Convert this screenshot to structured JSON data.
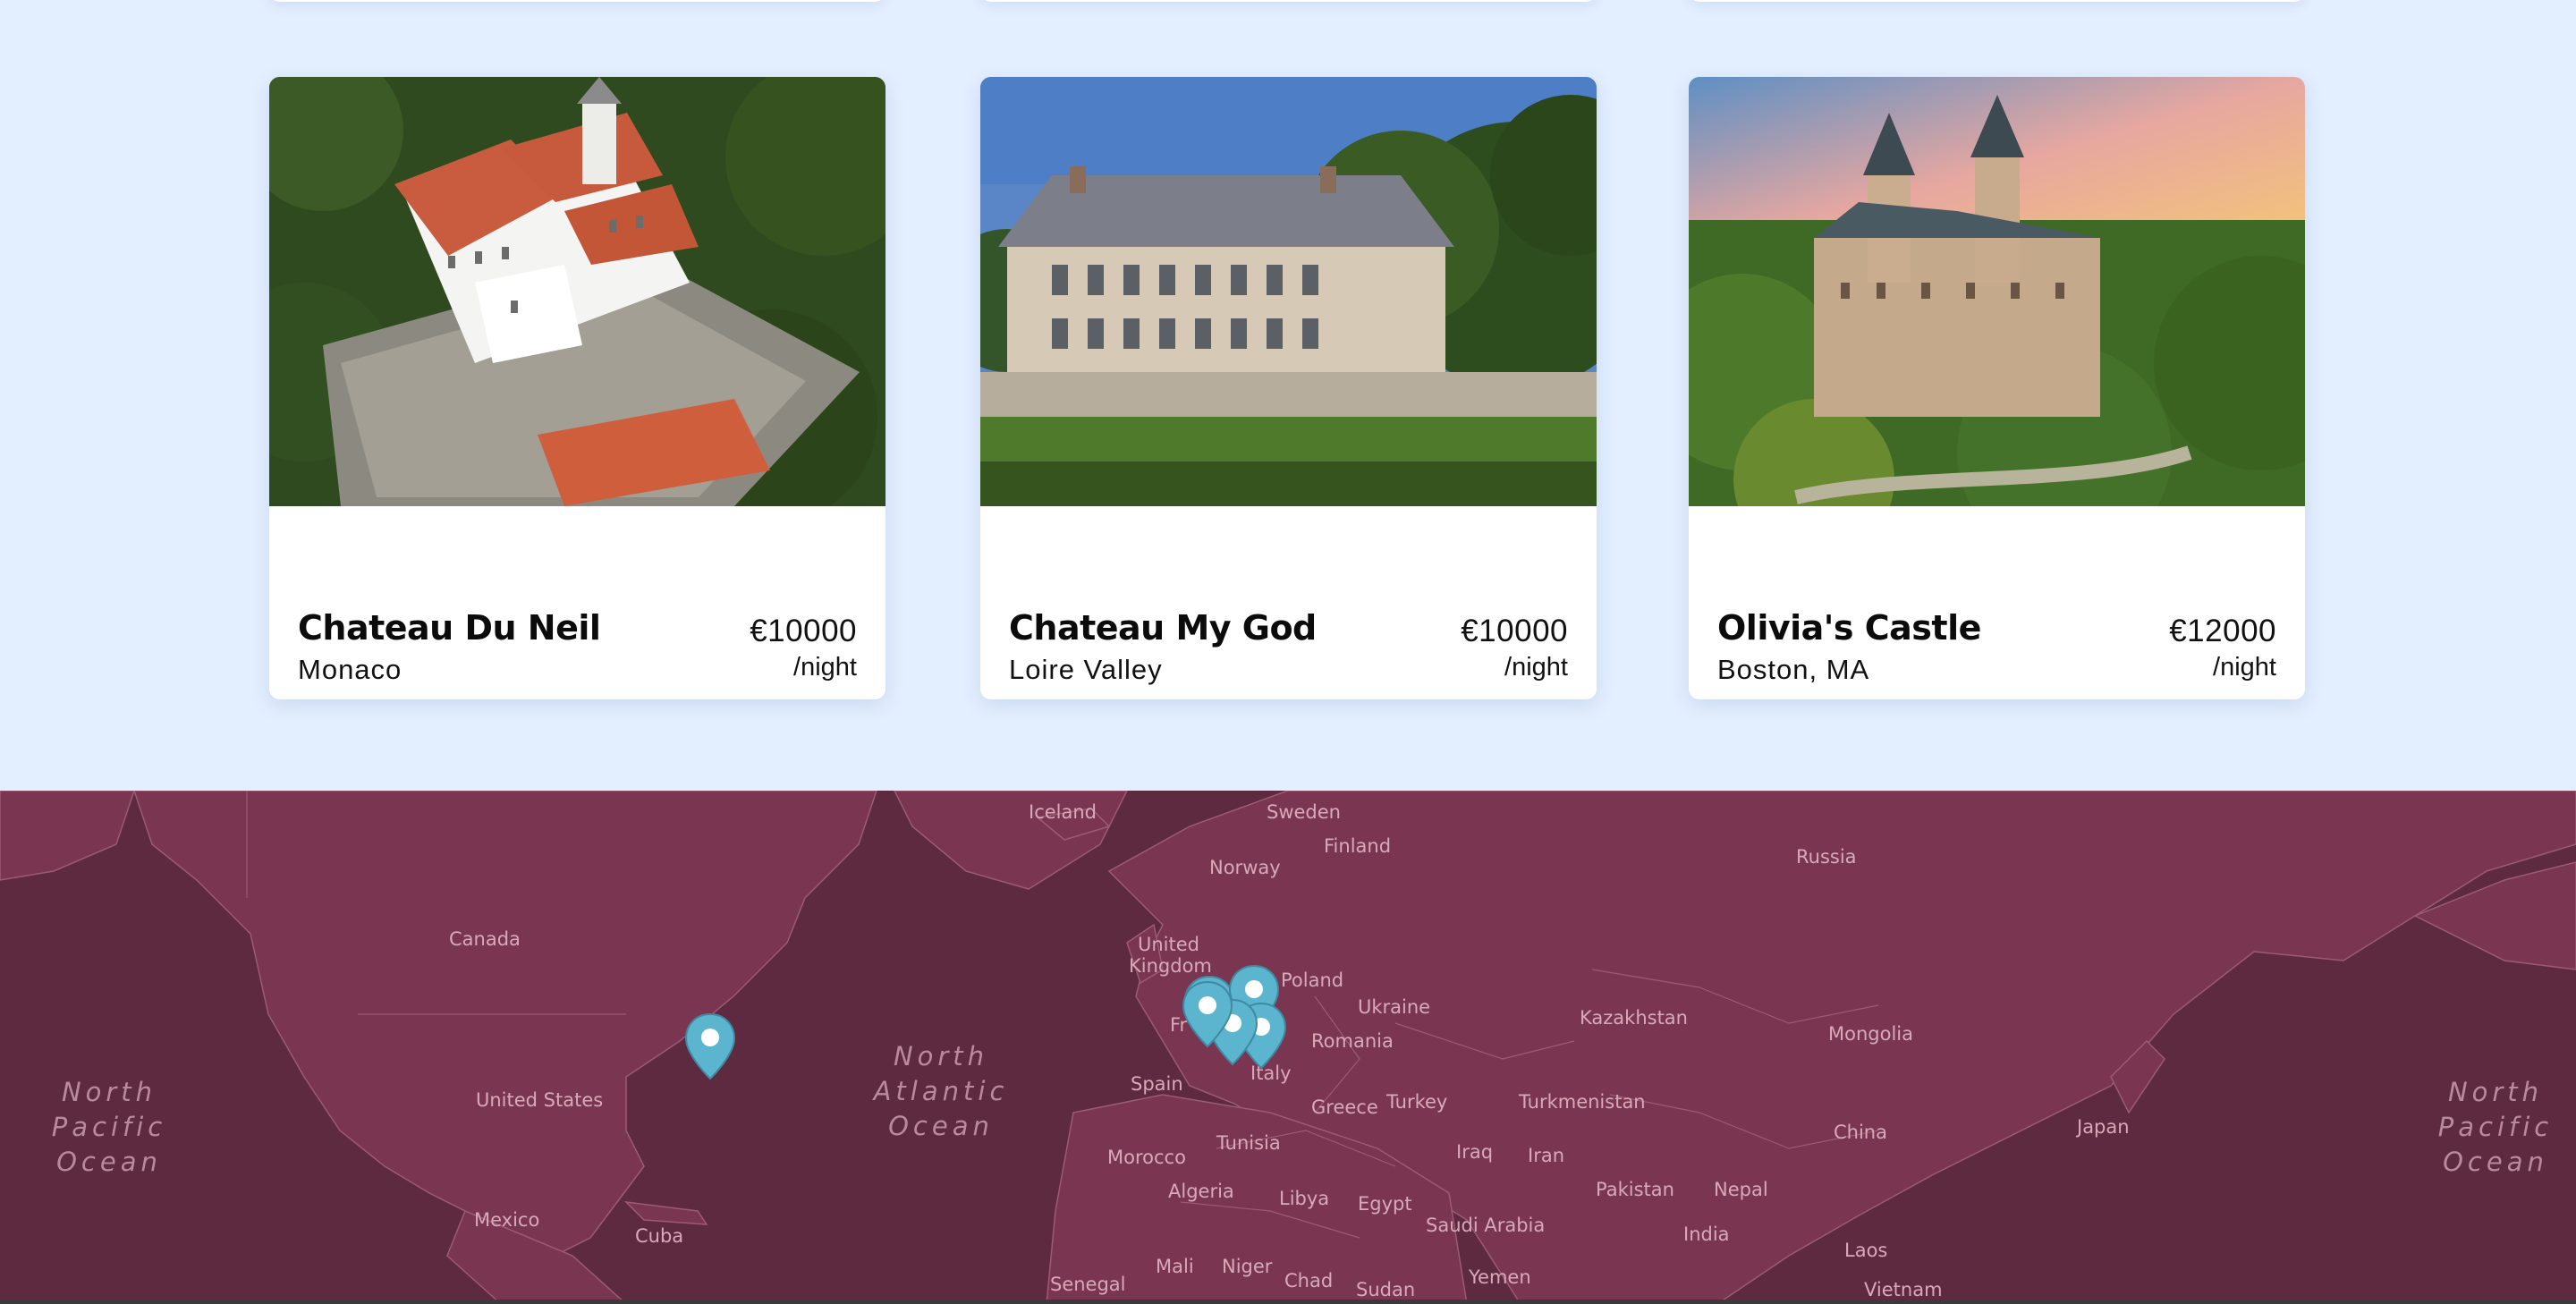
{
  "listings": [
    {
      "name": "Chateau Du Neil",
      "location": "Monaco",
      "price": "€10000",
      "per": "/night"
    },
    {
      "name": "Chateau My God",
      "location": "Loire Valley",
      "price": "€10000",
      "per": "/night"
    },
    {
      "name": "Olivia's Castle",
      "location": "Boston, MA",
      "price": "€12000",
      "per": "/night"
    }
  ],
  "map": {
    "labels": {
      "iceland": "Iceland",
      "sweden": "Sweden",
      "finland": "Finland",
      "norway": "Norway",
      "russia": "Russia",
      "canada": "Canada",
      "united_kingdom_1": "United",
      "united_kingdom_2": "Kingdom",
      "poland": "Poland",
      "ukraine": "Ukraine",
      "kazakhstan": "Kazakhstan",
      "mongolia": "Mongolia",
      "france": "Fr",
      "romania": "Romania",
      "italy": "Italy",
      "spain": "Spain",
      "greece": "Greece",
      "turkey": "Turkey",
      "turkmenistan": "Turkmenistan",
      "united_states": "United States",
      "china": "China",
      "japan": "Japan",
      "tunisia": "Tunisia",
      "morocco": "Morocco",
      "iraq": "Iraq",
      "iran": "Iran",
      "algeria": "Algeria",
      "libya": "Libya",
      "egypt": "Egypt",
      "pakistan": "Pakistan",
      "nepal": "Nepal",
      "mexico": "Mexico",
      "saudi_arabia": "Saudi Arabia",
      "india": "India",
      "cuba": "Cuba",
      "laos": "Laos",
      "mali": "Mali",
      "niger": "Niger",
      "chad": "Chad",
      "sudan": "Sudan",
      "yemen": "Yemen",
      "senegal": "Senegal",
      "vietnam": "Vietnam"
    },
    "oceans": {
      "north_pacific_left": [
        "North",
        "Pacific",
        "Ocean"
      ],
      "north_atlantic": [
        "North",
        "Atlantic",
        "Ocean"
      ],
      "north_pacific_right": [
        "North",
        "Pacific",
        "Ocean"
      ]
    },
    "marker_color": "#5bb5cf"
  },
  "colors": {
    "page_bg": "#e3efff",
    "map_sea": "#5e2a3f",
    "map_land": "#7a3650"
  }
}
